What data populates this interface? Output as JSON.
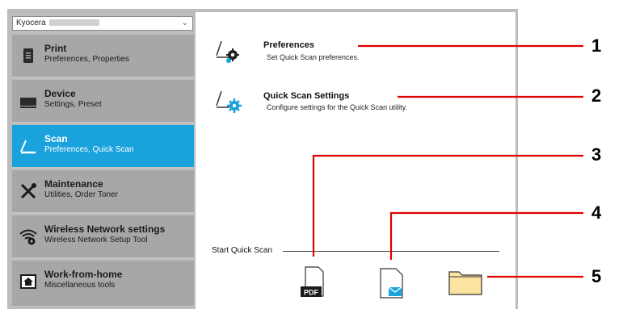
{
  "device_select": {
    "value": "Kyocera"
  },
  "sidebar": {
    "items": [
      {
        "title": "Print",
        "subtitle": "Preferences, Properties"
      },
      {
        "title": "Device",
        "subtitle": "Settings, Preset"
      },
      {
        "title": "Scan",
        "subtitle": "Preferences, Quick Scan"
      },
      {
        "title": "Maintenance",
        "subtitle": "Utilities, Order Toner"
      },
      {
        "title": "Wireless Network settings",
        "subtitle": "Wireless Network Setup Tool"
      },
      {
        "title": "Work-from-home",
        "subtitle": "Miscellaneous tools"
      }
    ]
  },
  "main": {
    "options": [
      {
        "title": "Preferences",
        "subtitle": "Set Quick Scan preferences."
      },
      {
        "title": "Quick Scan Settings",
        "subtitle": "Configure settings for the Quick Scan utility."
      }
    ],
    "quick_scan": {
      "label": "Start Quick Scan",
      "pdf_label": "PDF"
    }
  },
  "callouts": [
    "1",
    "2",
    "3",
    "4",
    "5"
  ],
  "colors": {
    "accent": "#1aa2dc",
    "callout_line": "#e00000"
  },
  "icons": {
    "print": "document-icon",
    "device": "printer-icon",
    "scan": "scanner-icon",
    "maintenance": "tools-icon",
    "wireless": "wifi-gear-icon",
    "work_from_home": "home-icon"
  }
}
